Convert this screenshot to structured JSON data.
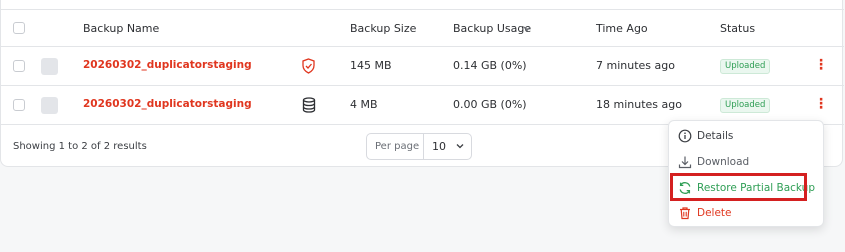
{
  "table": {
    "headers": {
      "name": "Backup Name",
      "size": "Backup Size",
      "usage": "Backup Usage",
      "time": "Time Ago",
      "status": "Status"
    },
    "rows": [
      {
        "name": "20260302_duplicatorstaging",
        "type_icon": "shield-icon",
        "size": "145 MB",
        "usage": "0.14 GB (0%)",
        "time": "7 minutes ago",
        "status": "Uploaded"
      },
      {
        "name": "20260302_duplicatorstaging",
        "type_icon": "database-icon",
        "size": "4 MB",
        "usage": "0.00 GB (0%)",
        "time": "18 minutes ago",
        "status": "Uploaded"
      }
    ]
  },
  "footer": {
    "summary": "Showing 1 to 2 of 2 results",
    "per_page_label": "Per page",
    "per_page_value": "10"
  },
  "menu": {
    "items": [
      {
        "label": "Details",
        "icon": "info-icon",
        "color": "#3c3f44"
      },
      {
        "label": "Download",
        "icon": "download-icon",
        "color": "#5a5e65"
      },
      {
        "label": "Restore Partial Backup",
        "icon": "refresh-icon",
        "color": "#2f9e55"
      },
      {
        "label": "Delete",
        "icon": "trash-icon",
        "color": "#e0361f"
      }
    ]
  },
  "colors": {
    "accent_red": "#e0361f",
    "status_green": "#2f9e55",
    "highlight_box": "#d42020"
  }
}
